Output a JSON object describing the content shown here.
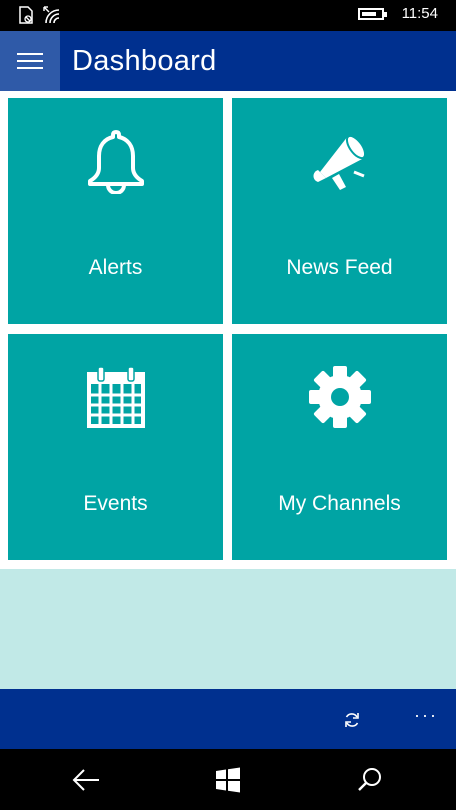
{
  "status_bar": {
    "time": "11:54",
    "icons": [
      "sim-status-icon",
      "wifi-icon",
      "battery-icon"
    ]
  },
  "app_bar": {
    "menu_icon": "hamburger-icon",
    "title": "Dashboard"
  },
  "tiles": [
    {
      "label": "Alerts",
      "icon": "bell-icon"
    },
    {
      "label": "News Feed",
      "icon": "megaphone-icon"
    },
    {
      "label": "Events",
      "icon": "calendar-icon"
    },
    {
      "label": "My Channels",
      "icon": "gear-icon"
    }
  ],
  "command_bar": {
    "refresh_icon": "refresh-icon",
    "more_label": "···"
  },
  "nav_bar": {
    "icons": [
      "back-icon",
      "windows-start-icon",
      "search-icon"
    ]
  },
  "colors": {
    "app_bar": "#00308f",
    "hamburger_bg": "#2f5aa8",
    "tile": "#00a4a4",
    "empty_area": "#c1e9e7",
    "system_bar": "#000000"
  }
}
